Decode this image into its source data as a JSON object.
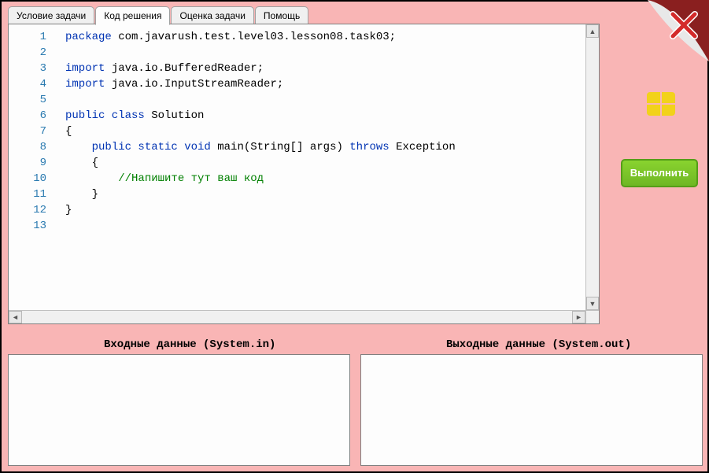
{
  "tabs": [
    {
      "label": "Условие задачи",
      "active": false
    },
    {
      "label": "Код решения",
      "active": true
    },
    {
      "label": "Оценка задачи",
      "active": false
    },
    {
      "label": "Помощь",
      "active": false
    }
  ],
  "editor": {
    "lines": [
      {
        "n": 1,
        "tokens": [
          {
            "t": "package",
            "c": "kw"
          },
          {
            "t": " com.javarush.test.level03.lesson08.task03;",
            "c": ""
          }
        ]
      },
      {
        "n": 2,
        "tokens": [
          {
            "t": "",
            "c": ""
          }
        ]
      },
      {
        "n": 3,
        "tokens": [
          {
            "t": "import",
            "c": "kw"
          },
          {
            "t": " java.io.BufferedReader;",
            "c": ""
          }
        ]
      },
      {
        "n": 4,
        "tokens": [
          {
            "t": "import",
            "c": "kw"
          },
          {
            "t": " java.io.InputStreamReader;",
            "c": ""
          }
        ]
      },
      {
        "n": 5,
        "tokens": [
          {
            "t": "",
            "c": ""
          }
        ]
      },
      {
        "n": 6,
        "tokens": [
          {
            "t": "public class",
            "c": "kw"
          },
          {
            "t": " Solution",
            "c": ""
          }
        ]
      },
      {
        "n": 7,
        "tokens": [
          {
            "t": "{",
            "c": ""
          }
        ]
      },
      {
        "n": 8,
        "tokens": [
          {
            "t": "    ",
            "c": ""
          },
          {
            "t": "public static void",
            "c": "kw"
          },
          {
            "t": " main(String[] args) ",
            "c": ""
          },
          {
            "t": "throws",
            "c": "kw"
          },
          {
            "t": " Exception",
            "c": ""
          }
        ]
      },
      {
        "n": 9,
        "tokens": [
          {
            "t": "    {",
            "c": ""
          }
        ]
      },
      {
        "n": 10,
        "tokens": [
          {
            "t": "        ",
            "c": ""
          },
          {
            "t": "//Напишите тут ваш код",
            "c": "cm"
          }
        ]
      },
      {
        "n": 11,
        "tokens": [
          {
            "t": "    }",
            "c": ""
          }
        ]
      },
      {
        "n": 12,
        "tokens": [
          {
            "t": "}",
            "c": ""
          }
        ]
      },
      {
        "n": 13,
        "tokens": [
          {
            "t": "",
            "c": ""
          }
        ]
      }
    ]
  },
  "io": {
    "input_label": "Входные данные (System.in)",
    "output_label": "Выходные данные (System.out)",
    "input_value": "",
    "output_value": ""
  },
  "buttons": {
    "run_label": "Выполнить"
  }
}
